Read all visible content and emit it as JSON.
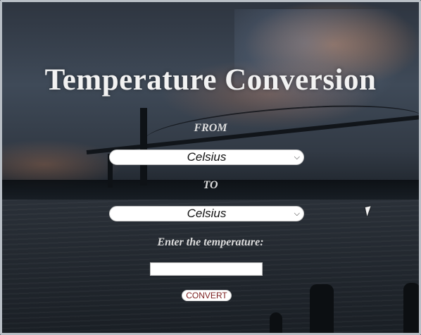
{
  "page": {
    "title": "Temperature Conversion"
  },
  "form": {
    "from_label": "FROM",
    "from_selected": "Celsius",
    "to_label": "TO",
    "to_selected": "Celsius",
    "enter_label": "Enter the temperature:",
    "temperature_value": "",
    "convert_label": "CONVERT"
  },
  "colors": {
    "title_text": "#f2f2f2",
    "convert_text": "#7a1d1d"
  },
  "icons": {
    "select_arrow": "chevron-down-icon",
    "pointer": "mouse-cursor-icon"
  }
}
